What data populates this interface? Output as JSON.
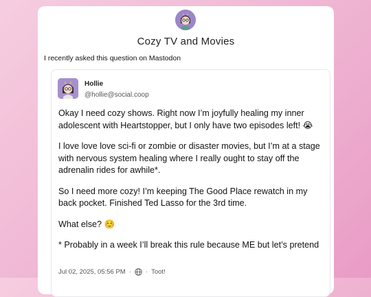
{
  "page": {
    "site_title": "Cozy TV and Movies",
    "intro_text": "I recently asked this question on Mastodon"
  },
  "post": {
    "author_name": "Hollie",
    "author_handle": "@hollie@social.coop",
    "paragraphs": [
      "Okay I need cozy shows. Right now I’m joyfully healing my inner adolescent with Heartstopper, but I only have two episodes left! 😭",
      "I love love love sci-fi or zombie or disaster movies, but I’m at a stage with nervous system healing where I really ought to stay off the adrenalin rides for awhile*.",
      "So I need more cozy! I’m keeping The Good Place rewatch in my back pocket. Finished Ted Lasso for the 3rd time.",
      "What else? ☺️",
      "* Probably in a week I’ll break this rule because ME but let’s pretend"
    ],
    "timestamp": "Jul 02, 2025, 05:56 PM",
    "separator": "·",
    "visibility_icon": "globe-icon",
    "app_name": "Toot!"
  },
  "colors": {
    "background_start": "#f6cde0",
    "background_end": "#e99cc6",
    "avatar_bg": "#9b86c9"
  }
}
